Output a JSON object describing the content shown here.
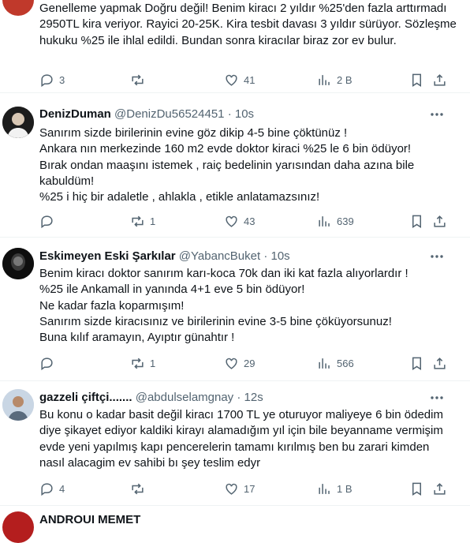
{
  "tweets": [
    {
      "body": "Genelleme yapmak Doğru değil! Benim kiracı 2 yıldır %25'den fazla arttırmadı 2950TL kira veriyor. Rayici 20-25K. Kira tesbit davası 3 yıldır sürüyor. Sözleşme hukuku %25 ile ihlal edildi. Bundan sonra kiracılar biraz zor ev bulur.",
      "replies": "3",
      "reposts": "",
      "likes": "41",
      "views": "2 B"
    },
    {
      "name": "DenizDuman",
      "handle": "@DenizDu56524451",
      "time": "10s",
      "body": "Sanırım sizde birilerinin evine göz dikip 4-5 bine çöktünüz !\nAnkara nın merkezinde 160 m2  evde doktor kiraci %25 le  6 bin ödüyor!\nBırak ondan maaşını istemek , raiç bedelinin yarısından daha azına  bile kabuldüm!\n%25 i hiç bir adaletle , ahlakla , etikle anlatamazsınız!",
      "replies": "",
      "reposts": "1",
      "likes": "43",
      "views": "639"
    },
    {
      "name": "Eskimeyen Eski Şarkılar",
      "handle": "@YabancBuket",
      "time": "10s",
      "body": "Benim kiracı doktor sanırım karı-koca 70k dan iki kat fazla alıyorlardır !\n%25 ile Ankamall in yanında 4+1 eve 5 bin ödüyor!\nNe kadar  fazla koparmışım!\nSanırım sizde kiracısınız ve birilerinin evine 3-5 bine çöküyorsunuz!\nBuna kılıf aramayın, Ayıptır günahtır !",
      "replies": "",
      "reposts": "1",
      "likes": "29",
      "views": "566"
    },
    {
      "name": "gazzeli çiftçi.......",
      "handle": "@abdulselamgnay",
      "time": "12s",
      "body": "Bu konu o kadar basit değil kiracı 1700 TL ye oturuyor maliyeye 6 bin ödedim diye şikayet ediyor kaldiki kirayı alamadığım yıl için bile beyanname vermişim  evde yeni yapılmış kapı pencerelerin tamamı kırılmış ben bu zarari kimden nasıl alacagim ev sahibi bı şey teslim edyr",
      "replies": "4",
      "reposts": "",
      "likes": "17",
      "views": "1 B"
    }
  ],
  "partial_next": {
    "name": "ANDROUI MEMET"
  },
  "separator": "·",
  "colors": {
    "text": "#0f1419",
    "muted": "#536471",
    "border": "#eff3f4"
  }
}
